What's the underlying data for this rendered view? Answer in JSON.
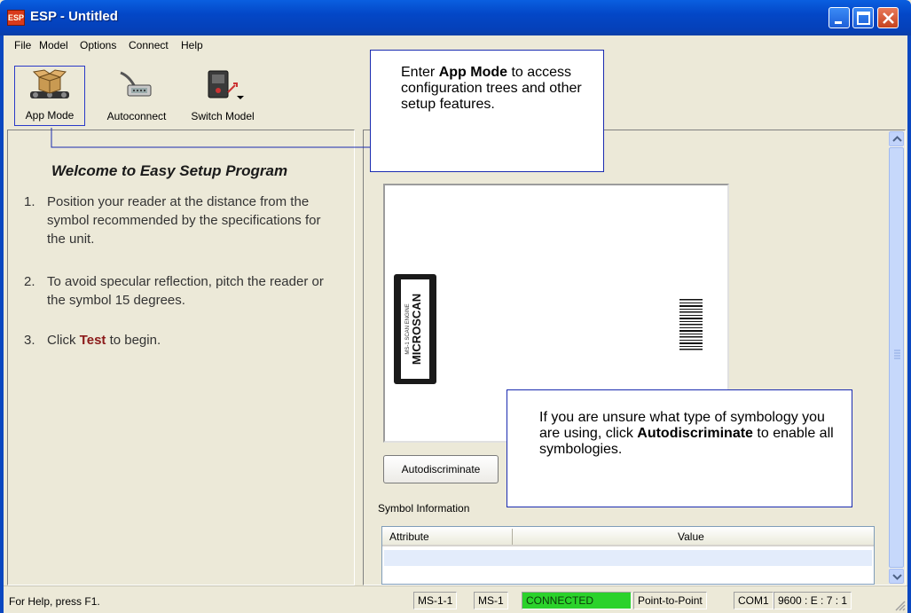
{
  "window": {
    "title": "ESP - Untitled",
    "app_icon_text": "ESP"
  },
  "menu": [
    "File",
    "Model",
    "Options",
    "Connect",
    "Help"
  ],
  "toolbar": {
    "app_mode": "App Mode",
    "autoconnect": "Autoconnect",
    "switch_model": "Switch Model"
  },
  "welcome": {
    "heading": "Welcome to Easy Setup Program",
    "steps": [
      {
        "num": "1.",
        "text": "Position your reader at the distance from the symbol recommended by the specifications for the unit."
      },
      {
        "num": "2.",
        "text": "To avoid specular reflection, pitch the reader or the symbol 15 degrees."
      },
      {
        "num": "3.",
        "pre": "Click ",
        "bold": "Test",
        "post": " to begin."
      }
    ]
  },
  "callouts": {
    "app_mode": {
      "pre": "Enter ",
      "bold": "App Mode",
      "post": " to access configuration trees and other setup features."
    },
    "autod": {
      "pre": "If you are unsure what type of symbology you are using, click ",
      "bold": "Autodiscriminate",
      "post": " to enable all symbologies."
    }
  },
  "reader_image": {
    "brand": "MICROSCAN",
    "model": "MS-1 SCAN ENGINE"
  },
  "right_pane": {
    "autodiscriminate_button": "Autodiscriminate",
    "symbol_info_label": "Symbol Information",
    "columns": [
      "Attribute",
      "Value"
    ]
  },
  "status": {
    "help": "For Help, press F1.",
    "panels": [
      "MS-1-1",
      "MS-1",
      "CONNECTED",
      "Point-to-Point",
      "COM1",
      "9600 : E : 7 : 1"
    ]
  },
  "colors": {
    "connected": "#2bd22b",
    "title_bar": "#0347c7",
    "callout_border": "#1a2bb0"
  }
}
